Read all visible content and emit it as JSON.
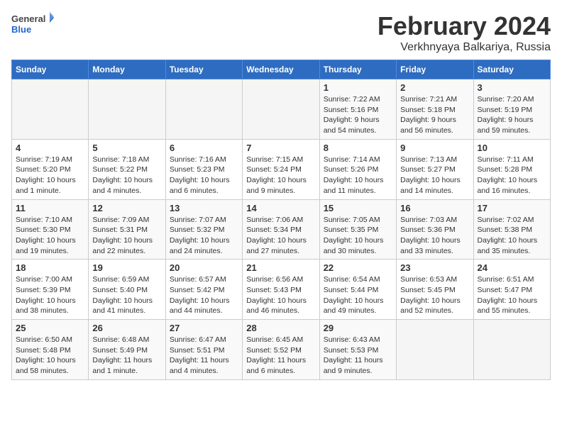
{
  "header": {
    "logo_general": "General",
    "logo_blue": "Blue",
    "main_title": "February 2024",
    "sub_title": "Verkhnyaya Balkariya, Russia"
  },
  "calendar": {
    "days_of_week": [
      "Sunday",
      "Monday",
      "Tuesday",
      "Wednesday",
      "Thursday",
      "Friday",
      "Saturday"
    ],
    "weeks": [
      [
        {
          "day": "",
          "sunrise": "",
          "sunset": "",
          "daylight": "",
          "empty": true
        },
        {
          "day": "",
          "sunrise": "",
          "sunset": "",
          "daylight": "",
          "empty": true
        },
        {
          "day": "",
          "sunrise": "",
          "sunset": "",
          "daylight": "",
          "empty": true
        },
        {
          "day": "",
          "sunrise": "",
          "sunset": "",
          "daylight": "",
          "empty": true
        },
        {
          "day": "1",
          "sunrise": "Sunrise: 7:22 AM",
          "sunset": "Sunset: 5:16 PM",
          "daylight": "Daylight: 9 hours and 54 minutes.",
          "empty": false
        },
        {
          "day": "2",
          "sunrise": "Sunrise: 7:21 AM",
          "sunset": "Sunset: 5:18 PM",
          "daylight": "Daylight: 9 hours and 56 minutes.",
          "empty": false
        },
        {
          "day": "3",
          "sunrise": "Sunrise: 7:20 AM",
          "sunset": "Sunset: 5:19 PM",
          "daylight": "Daylight: 9 hours and 59 minutes.",
          "empty": false
        }
      ],
      [
        {
          "day": "4",
          "sunrise": "Sunrise: 7:19 AM",
          "sunset": "Sunset: 5:20 PM",
          "daylight": "Daylight: 10 hours and 1 minute.",
          "empty": false
        },
        {
          "day": "5",
          "sunrise": "Sunrise: 7:18 AM",
          "sunset": "Sunset: 5:22 PM",
          "daylight": "Daylight: 10 hours and 4 minutes.",
          "empty": false
        },
        {
          "day": "6",
          "sunrise": "Sunrise: 7:16 AM",
          "sunset": "Sunset: 5:23 PM",
          "daylight": "Daylight: 10 hours and 6 minutes.",
          "empty": false
        },
        {
          "day": "7",
          "sunrise": "Sunrise: 7:15 AM",
          "sunset": "Sunset: 5:24 PM",
          "daylight": "Daylight: 10 hours and 9 minutes.",
          "empty": false
        },
        {
          "day": "8",
          "sunrise": "Sunrise: 7:14 AM",
          "sunset": "Sunset: 5:26 PM",
          "daylight": "Daylight: 10 hours and 11 minutes.",
          "empty": false
        },
        {
          "day": "9",
          "sunrise": "Sunrise: 7:13 AM",
          "sunset": "Sunset: 5:27 PM",
          "daylight": "Daylight: 10 hours and 14 minutes.",
          "empty": false
        },
        {
          "day": "10",
          "sunrise": "Sunrise: 7:11 AM",
          "sunset": "Sunset: 5:28 PM",
          "daylight": "Daylight: 10 hours and 16 minutes.",
          "empty": false
        }
      ],
      [
        {
          "day": "11",
          "sunrise": "Sunrise: 7:10 AM",
          "sunset": "Sunset: 5:30 PM",
          "daylight": "Daylight: 10 hours and 19 minutes.",
          "empty": false
        },
        {
          "day": "12",
          "sunrise": "Sunrise: 7:09 AM",
          "sunset": "Sunset: 5:31 PM",
          "daylight": "Daylight: 10 hours and 22 minutes.",
          "empty": false
        },
        {
          "day": "13",
          "sunrise": "Sunrise: 7:07 AM",
          "sunset": "Sunset: 5:32 PM",
          "daylight": "Daylight: 10 hours and 24 minutes.",
          "empty": false
        },
        {
          "day": "14",
          "sunrise": "Sunrise: 7:06 AM",
          "sunset": "Sunset: 5:34 PM",
          "daylight": "Daylight: 10 hours and 27 minutes.",
          "empty": false
        },
        {
          "day": "15",
          "sunrise": "Sunrise: 7:05 AM",
          "sunset": "Sunset: 5:35 PM",
          "daylight": "Daylight: 10 hours and 30 minutes.",
          "empty": false
        },
        {
          "day": "16",
          "sunrise": "Sunrise: 7:03 AM",
          "sunset": "Sunset: 5:36 PM",
          "daylight": "Daylight: 10 hours and 33 minutes.",
          "empty": false
        },
        {
          "day": "17",
          "sunrise": "Sunrise: 7:02 AM",
          "sunset": "Sunset: 5:38 PM",
          "daylight": "Daylight: 10 hours and 35 minutes.",
          "empty": false
        }
      ],
      [
        {
          "day": "18",
          "sunrise": "Sunrise: 7:00 AM",
          "sunset": "Sunset: 5:39 PM",
          "daylight": "Daylight: 10 hours and 38 minutes.",
          "empty": false
        },
        {
          "day": "19",
          "sunrise": "Sunrise: 6:59 AM",
          "sunset": "Sunset: 5:40 PM",
          "daylight": "Daylight: 10 hours and 41 minutes.",
          "empty": false
        },
        {
          "day": "20",
          "sunrise": "Sunrise: 6:57 AM",
          "sunset": "Sunset: 5:42 PM",
          "daylight": "Daylight: 10 hours and 44 minutes.",
          "empty": false
        },
        {
          "day": "21",
          "sunrise": "Sunrise: 6:56 AM",
          "sunset": "Sunset: 5:43 PM",
          "daylight": "Daylight: 10 hours and 46 minutes.",
          "empty": false
        },
        {
          "day": "22",
          "sunrise": "Sunrise: 6:54 AM",
          "sunset": "Sunset: 5:44 PM",
          "daylight": "Daylight: 10 hours and 49 minutes.",
          "empty": false
        },
        {
          "day": "23",
          "sunrise": "Sunrise: 6:53 AM",
          "sunset": "Sunset: 5:45 PM",
          "daylight": "Daylight: 10 hours and 52 minutes.",
          "empty": false
        },
        {
          "day": "24",
          "sunrise": "Sunrise: 6:51 AM",
          "sunset": "Sunset: 5:47 PM",
          "daylight": "Daylight: 10 hours and 55 minutes.",
          "empty": false
        }
      ],
      [
        {
          "day": "25",
          "sunrise": "Sunrise: 6:50 AM",
          "sunset": "Sunset: 5:48 PM",
          "daylight": "Daylight: 10 hours and 58 minutes.",
          "empty": false
        },
        {
          "day": "26",
          "sunrise": "Sunrise: 6:48 AM",
          "sunset": "Sunset: 5:49 PM",
          "daylight": "Daylight: 11 hours and 1 minute.",
          "empty": false
        },
        {
          "day": "27",
          "sunrise": "Sunrise: 6:47 AM",
          "sunset": "Sunset: 5:51 PM",
          "daylight": "Daylight: 11 hours and 4 minutes.",
          "empty": false
        },
        {
          "day": "28",
          "sunrise": "Sunrise: 6:45 AM",
          "sunset": "Sunset: 5:52 PM",
          "daylight": "Daylight: 11 hours and 6 minutes.",
          "empty": false
        },
        {
          "day": "29",
          "sunrise": "Sunrise: 6:43 AM",
          "sunset": "Sunset: 5:53 PM",
          "daylight": "Daylight: 11 hours and 9 minutes.",
          "empty": false
        },
        {
          "day": "",
          "sunrise": "",
          "sunset": "",
          "daylight": "",
          "empty": true
        },
        {
          "day": "",
          "sunrise": "",
          "sunset": "",
          "daylight": "",
          "empty": true
        }
      ]
    ]
  }
}
